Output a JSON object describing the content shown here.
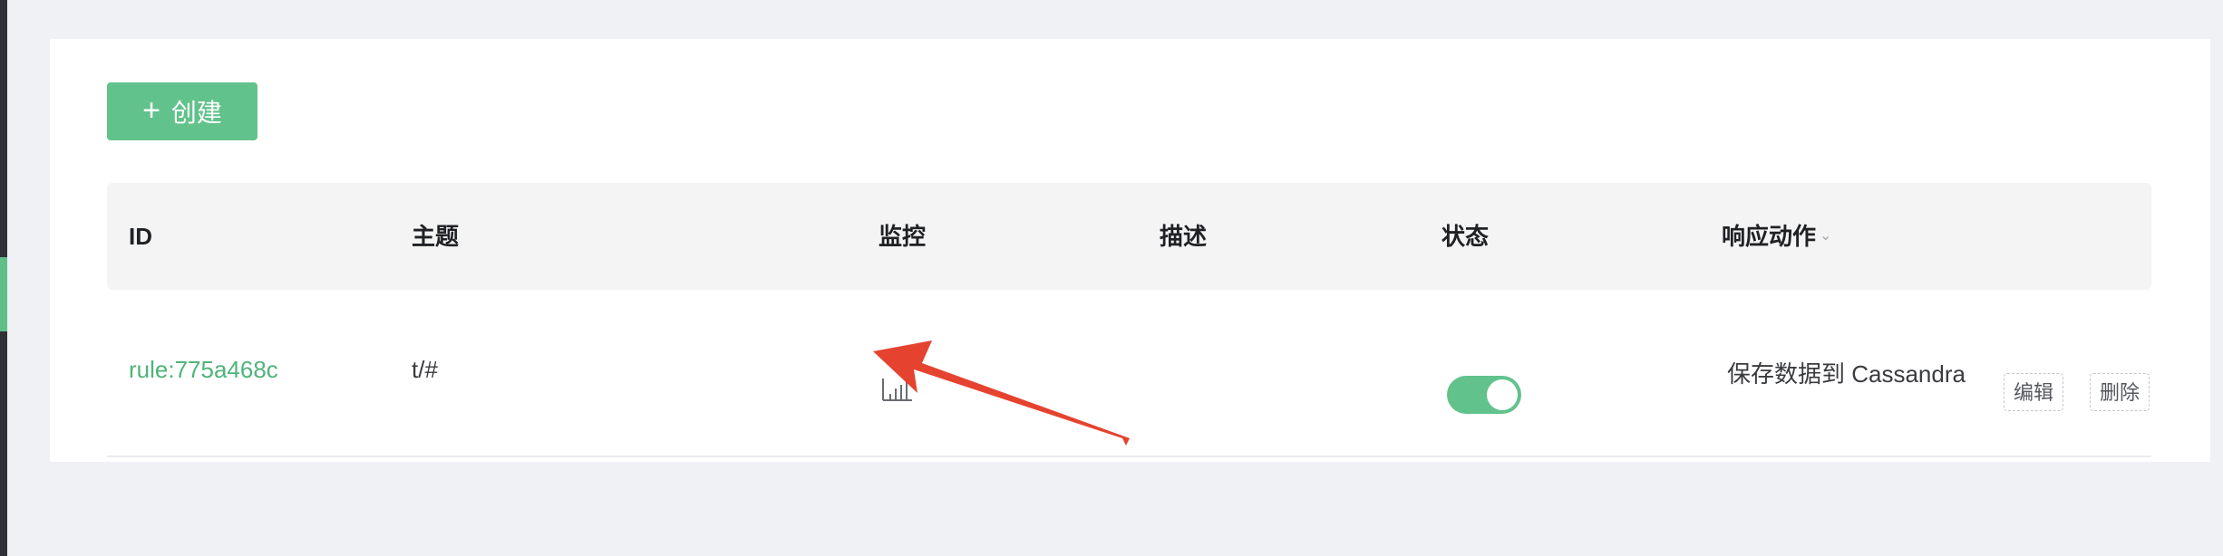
{
  "toolbar": {
    "create_label": "创建",
    "create_icon": "plus-icon"
  },
  "table": {
    "columns": [
      "ID",
      "主题",
      "监控",
      "描述",
      "状态",
      "响应动作"
    ],
    "rows": [
      {
        "id": "rule:775a468c",
        "topic": "t/#",
        "monitor_icon": "bar-chart-icon",
        "description": "",
        "enabled": true,
        "action": "保存数据到 Cassandra",
        "edit_label": "编辑",
        "delete_label": "删除"
      }
    ]
  },
  "colors": {
    "accent": "#62c28c",
    "link": "#4fb47a",
    "annotation_arrow": "#e5432f"
  }
}
